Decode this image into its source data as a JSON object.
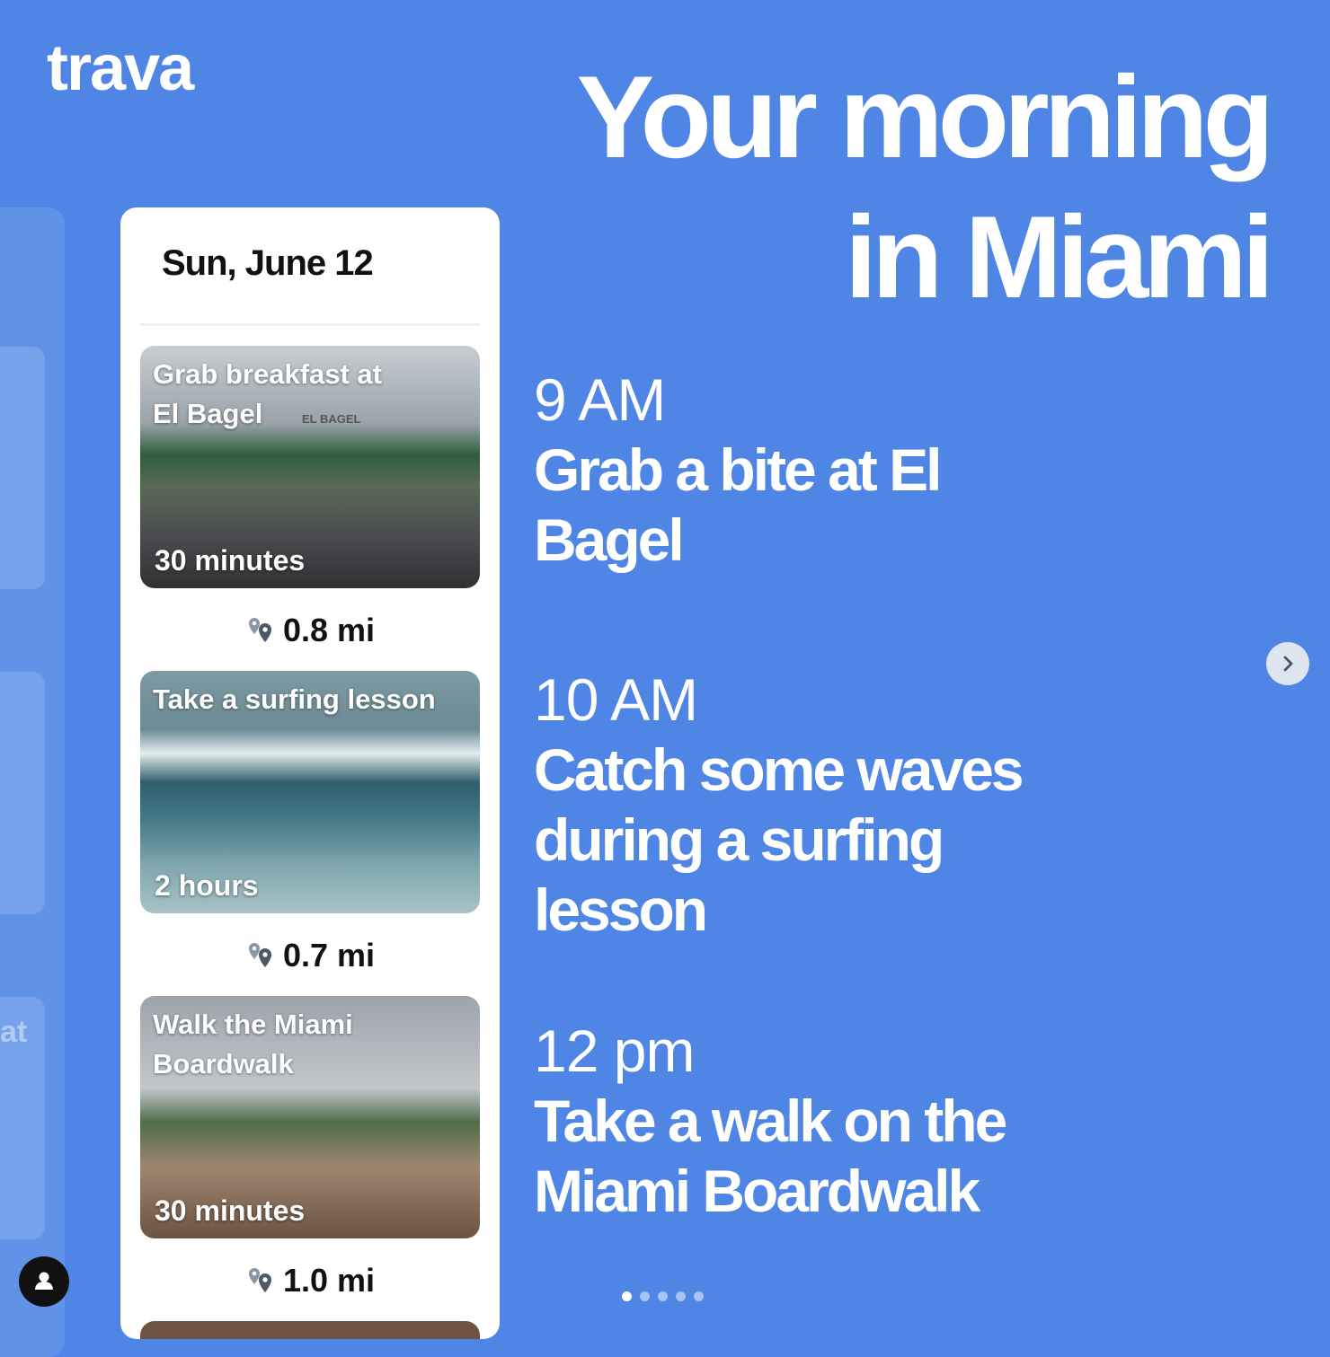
{
  "brand": {
    "name": "trava"
  },
  "itinerary": {
    "date": "Sun, June 12",
    "items": [
      {
        "title": "Grab breakfast at El Bagel",
        "sign": "EL BAGEL",
        "duration": "30 minutes",
        "distance": "0.8 mi"
      },
      {
        "title": "Take a surfing lesson",
        "duration": "2 hours",
        "distance": "0.7 mi"
      },
      {
        "title": "Walk the Miami Boardwalk",
        "duration": "30 minutes",
        "distance": "1.0 mi"
      }
    ]
  },
  "headline": {
    "line1": "Your morning",
    "line2": "in Miami"
  },
  "schedule": [
    {
      "time": "9 AM",
      "activity": "Grab a bite at El Bagel"
    },
    {
      "time": "10 AM",
      "activity": "Catch some waves during a surfing lesson"
    },
    {
      "time": "12 pm",
      "activity": "Take a walk on the Miami Boardwalk"
    }
  ],
  "carousel": {
    "total": 5,
    "active": 1
  },
  "ghost_card": {
    "partial_text": "at"
  },
  "icons": {
    "next": "chevron-right-icon",
    "avatar": "user-avatar-icon",
    "pin": "location-pin-icon"
  },
  "colors": {
    "background": "#4f86e6",
    "card": "#ffffff",
    "text_on_blue": "#ffffff"
  }
}
